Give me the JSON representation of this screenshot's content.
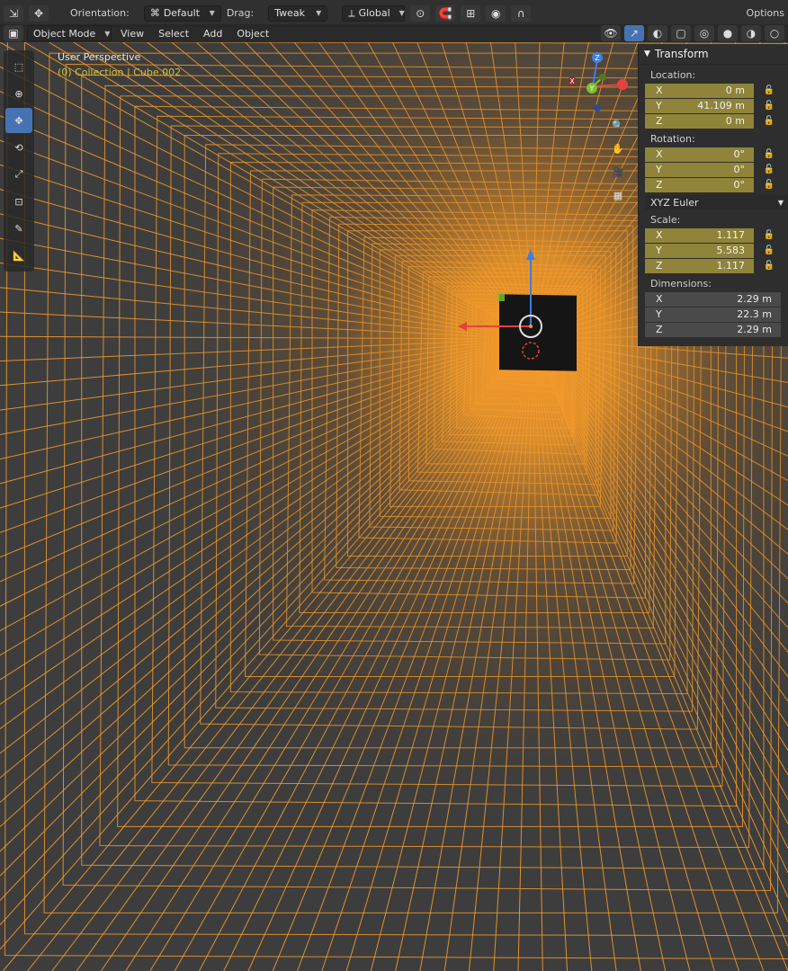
{
  "topbar": {
    "orientation_label": "Orientation:",
    "orientation_value": "Default",
    "drag_label": "Drag:",
    "drag_value": "Tweak",
    "transform_space": "Global",
    "options_label": "Options"
  },
  "header": {
    "mode": "Object Mode",
    "menus": [
      "View",
      "Select",
      "Add",
      "Object"
    ]
  },
  "viewport": {
    "title": "User Perspective",
    "subtitle": "(0) Collection | Cube.002",
    "wire_color": "#f39a2a",
    "background_color": "#3d3d3d",
    "active_tool": "move"
  },
  "gizmo": {
    "z": "Z",
    "y": "Y",
    "x": "X"
  },
  "transform_panel": {
    "title": "Transform",
    "location_label": "Location:",
    "location": [
      {
        "axis": "X",
        "value": "0 m"
      },
      {
        "axis": "Y",
        "value": "41.109 m"
      },
      {
        "axis": "Z",
        "value": "0 m"
      }
    ],
    "rotation_label": "Rotation:",
    "rotation": [
      {
        "axis": "X",
        "value": "0°"
      },
      {
        "axis": "Y",
        "value": "0°"
      },
      {
        "axis": "Z",
        "value": "0°"
      }
    ],
    "rotation_mode": "XYZ Euler",
    "scale_label": "Scale:",
    "scale": [
      {
        "axis": "X",
        "value": "1.117"
      },
      {
        "axis": "Y",
        "value": "5.583"
      },
      {
        "axis": "Z",
        "value": "1.117"
      }
    ],
    "dimensions_label": "Dimensions:",
    "dimensions": [
      {
        "axis": "X",
        "value": "2.29 m"
      },
      {
        "axis": "Y",
        "value": "22.3 m"
      },
      {
        "axis": "Z",
        "value": "2.29 m"
      }
    ]
  },
  "colors": {
    "accent": "#4772b3",
    "animated_field": "#8f8439",
    "collection_text": "#d2c23c",
    "axis_x": "#e8413d",
    "axis_y": "#7cc22e",
    "axis_z": "#3f7fe0"
  }
}
